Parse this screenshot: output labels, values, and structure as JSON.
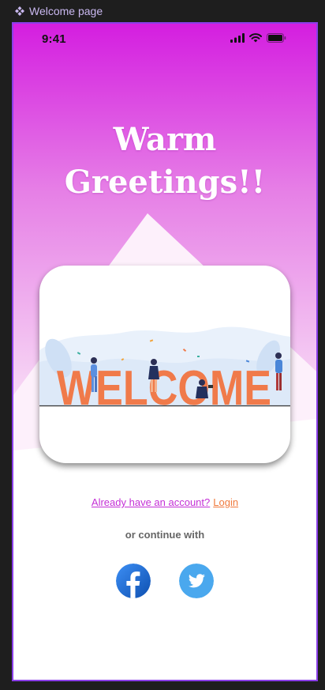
{
  "frame": {
    "label": "Welcome page",
    "icon": "component-diamond-icon"
  },
  "status_bar": {
    "time": "9:41",
    "icons": [
      "signal-icon",
      "wifi-icon",
      "battery-icon"
    ]
  },
  "greeting": {
    "line1": "Warm",
    "line2": "Greetings!!"
  },
  "illustration": {
    "word": "WELCOME"
  },
  "auth": {
    "prompt": "Already have an account?",
    "login_label": "Login"
  },
  "social": {
    "divider_text": "or continue with",
    "buttons": [
      "facebook-icon",
      "twitter-icon"
    ]
  },
  "colors": {
    "gradient_top": "#d41ee0",
    "gradient_bottom": "#f2c3f0",
    "accent_pink": "#c42fd6",
    "accent_orange": "#f07a3d",
    "frame_border": "#8a3ee8",
    "facebook_blue": "#1976d2",
    "twitter_blue": "#4aa8ee"
  }
}
